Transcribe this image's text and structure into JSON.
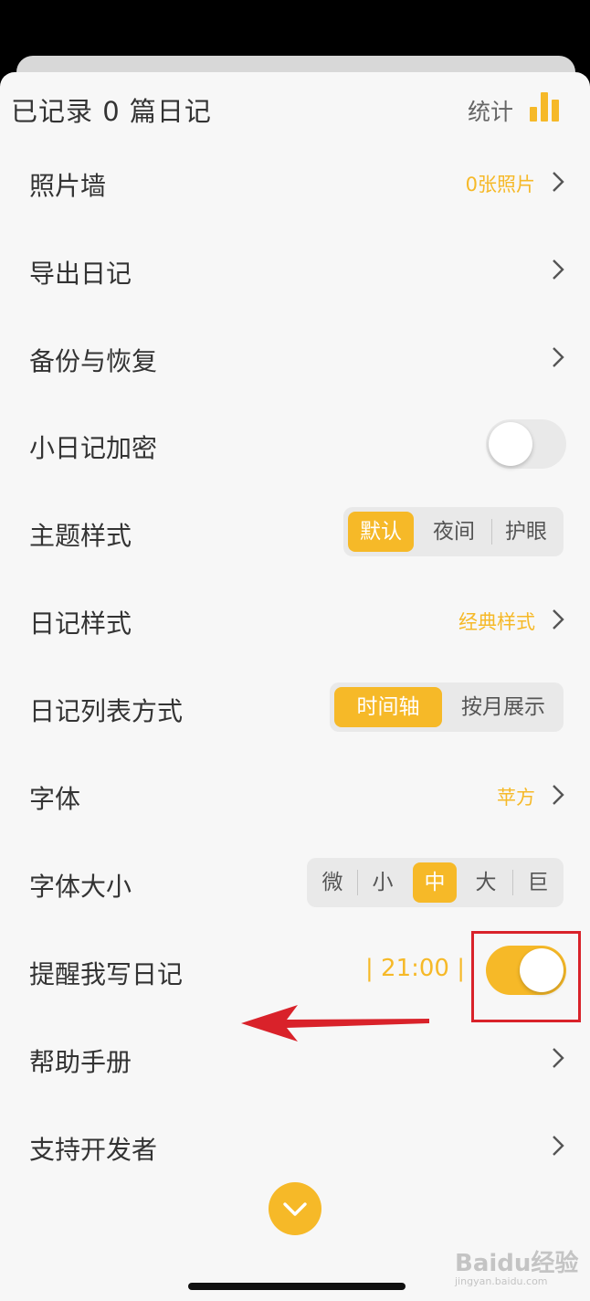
{
  "header": {
    "title": "已记录 0 篇日记",
    "stats_label": "统计",
    "stats_icon": "bar-chart-icon"
  },
  "rows": {
    "photo_wall": {
      "label": "照片墙",
      "value": "0张照片"
    },
    "export": {
      "label": "导出日记"
    },
    "backup": {
      "label": "备份与恢复"
    },
    "encrypt": {
      "label": "小日记加密",
      "enabled": false
    },
    "theme": {
      "label": "主题样式",
      "options": [
        "默认",
        "夜间",
        "护眼"
      ],
      "selected": "默认"
    },
    "diary_style": {
      "label": "日记样式",
      "value": "经典样式"
    },
    "list_mode": {
      "label": "日记列表方式",
      "options": [
        "时间轴",
        "按月展示"
      ],
      "selected": "时间轴"
    },
    "font": {
      "label": "字体",
      "value": "苹方"
    },
    "font_size": {
      "label": "字体大小",
      "options": [
        "微",
        "小",
        "中",
        "大",
        "巨"
      ],
      "selected": "中"
    },
    "reminder": {
      "label": "提醒我写日记",
      "time": "| 21:00 |",
      "enabled": true
    },
    "help": {
      "label": "帮助手册"
    },
    "support": {
      "label": "支持开发者"
    }
  },
  "watermark": {
    "text": "Baidu经验",
    "sub": "jingyan.baidu.com"
  },
  "colors": {
    "accent": "#f6b928",
    "annotation": "#d9222a"
  }
}
